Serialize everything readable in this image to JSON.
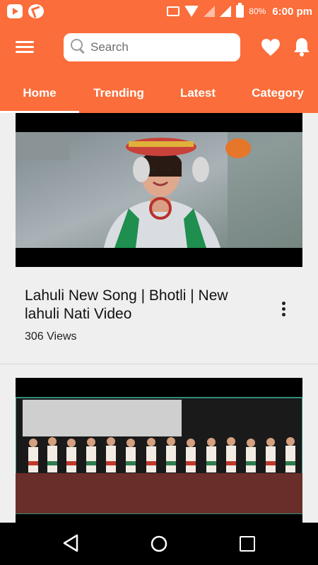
{
  "status_bar": {
    "battery_percent": "80%",
    "time": "6:00 pm",
    "icons": [
      "youtube-notification-icon",
      "app-notification-icon",
      "cast-icon",
      "wifi-icon",
      "signal-icon",
      "signal-icon",
      "battery-icon"
    ]
  },
  "search": {
    "placeholder": "Search",
    "value": ""
  },
  "tabs": [
    {
      "label": "Home",
      "active": true
    },
    {
      "label": "Trending",
      "active": false
    },
    {
      "label": "Latest",
      "active": false
    },
    {
      "label": "Category",
      "active": false
    }
  ],
  "videos": [
    {
      "title": "Lahuli New Song | Bhotli | New lahuli Nati Video",
      "views": "306 Views"
    },
    {
      "title": "",
      "views": ""
    }
  ],
  "colors": {
    "brand": "#fb6d3a",
    "background": "#efefef",
    "text": "#111111",
    "nav_bar": "#000000"
  }
}
